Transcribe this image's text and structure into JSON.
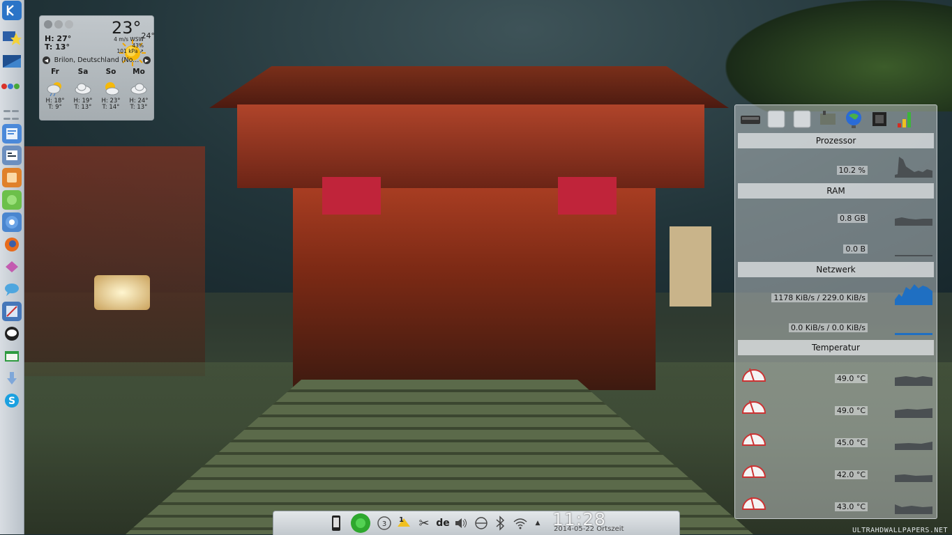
{
  "wallpaper": {
    "credit": "ULTRAHDWALLPAPERS.NET"
  },
  "dock": {
    "items": [
      {
        "name": "kde-menu-icon"
      },
      {
        "name": "folder-favorites-icon"
      },
      {
        "name": "desktop-preview-icon"
      },
      {
        "name": "app-window-1-icon"
      },
      {
        "name": "app-window-2-icon"
      },
      {
        "name": "app-window-3-icon"
      },
      {
        "name": "app-window-4-icon"
      },
      {
        "name": "chromium-icon"
      },
      {
        "name": "firefox-icon"
      },
      {
        "name": "app-window-5-icon"
      },
      {
        "name": "chat-icon"
      },
      {
        "name": "app-window-6-icon"
      },
      {
        "name": "messenger-icon"
      },
      {
        "name": "app-window-7-icon"
      },
      {
        "name": "download-icon"
      },
      {
        "name": "skype-icon"
      }
    ]
  },
  "weather": {
    "high": "H: 27°",
    "low": "T: 13°",
    "current_temp": "23°",
    "feels_temp": "24°",
    "wind": "4 m/s WSW",
    "humidity": "43%",
    "pressure": "101 kPa ↗",
    "location": "Brilon, Deutschland (No...",
    "forecast": [
      {
        "day": "Fr",
        "high": "H: 18°",
        "low": "T: 9°",
        "icon": "cloud-rain-sun-icon"
      },
      {
        "day": "Sa",
        "high": "H: 19°",
        "low": "T: 13°",
        "icon": "cloud-icon"
      },
      {
        "day": "So",
        "high": "H: 23°",
        "low": "T: 14°",
        "icon": "sun-cloud-icon"
      },
      {
        "day": "Mo",
        "high": "H: 24°",
        "low": "T: 13°",
        "icon": "cloud-icon"
      }
    ]
  },
  "sysmon": {
    "sections": {
      "cpu": "Prozessor",
      "ram": "RAM",
      "net": "Netzwerk",
      "temp": "Temperatur"
    },
    "cpu_value": "10.2 %",
    "ram_value": "0.8 GB",
    "swap_value": "0.0 B",
    "net_value_1": "1178 KiB/s / 229.0 KiB/s",
    "net_value_2": "0.0 KiB/s / 0.0 KiB/s",
    "temps": [
      "49.0 °C",
      "49.0 °C",
      "45.0 °C",
      "42.0 °C",
      "43.0 °C"
    ],
    "colors": {
      "net_graph": "#1f6fc2",
      "cpu_graph": "#4a4f52"
    }
  },
  "panel": {
    "language": "de",
    "clock": "11:28",
    "date": "2014-05-22 Ortszeit",
    "badge": "1"
  }
}
